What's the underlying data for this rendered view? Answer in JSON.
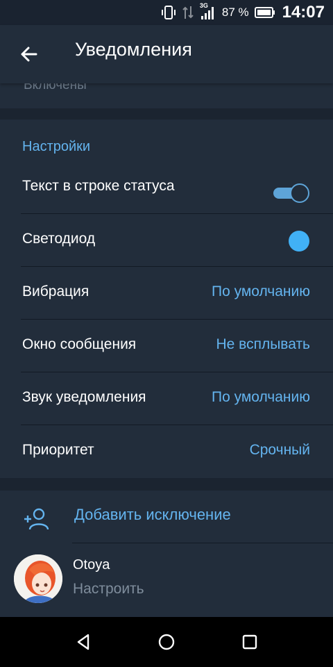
{
  "status_bar": {
    "network": "3G",
    "battery_percent": "87 %",
    "time": "14:07"
  },
  "app_bar": {
    "title": "Уведомления"
  },
  "previous_section": {
    "ghost_text": "Включены"
  },
  "settings": {
    "header": "Настройки",
    "rows": [
      {
        "label": "Текст в строке статуса",
        "control": "toggle",
        "toggle_on": true
      },
      {
        "label": "Светодиод",
        "control": "color-dot",
        "color": "#41b1f6"
      },
      {
        "label": "Вибрация",
        "value": "По умолчанию"
      },
      {
        "label": "Окно сообщения",
        "value": "Не всплывать"
      },
      {
        "label": "Звук уведомления",
        "value": "По умолчанию"
      },
      {
        "label": "Приоритет",
        "value": "Срочный"
      }
    ]
  },
  "exceptions": {
    "add_label": "Добавить исключение",
    "user": {
      "name": "Otoya",
      "action": "Настроить"
    }
  },
  "colors": {
    "accent": "#64b4ef",
    "background": "#1b2430",
    "card": "#222d3b"
  },
  "icons": {
    "back": "arrow-left",
    "add_user": "person-add",
    "nav_back": "triangle-left",
    "nav_home": "circle",
    "nav_recents": "square"
  }
}
